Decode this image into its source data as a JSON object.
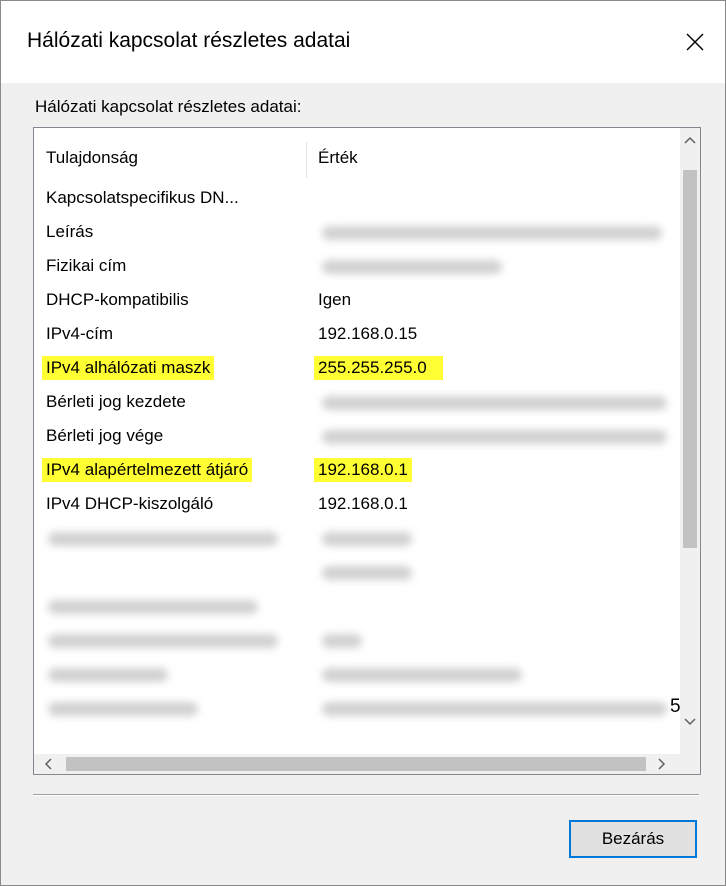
{
  "dialog": {
    "title": "Hálózati kapcsolat részletes adatai",
    "group_label": "Hálózati kapcsolat részletes adatai:",
    "close_button_label": "Bezárás"
  },
  "listview": {
    "columns": [
      "Tulajdonság",
      "Érték"
    ],
    "rows": [
      {
        "prop": "Kapcsolatspecifikus DN...",
        "val": ""
      },
      {
        "prop": "Leírás",
        "val": ""
      },
      {
        "prop": "Fizikai cím",
        "val": ""
      },
      {
        "prop": "DHCP-kompatibilis",
        "val": "Igen"
      },
      {
        "prop": "IPv4-cím",
        "val": "192.168.0.15"
      },
      {
        "prop": "IPv4 alhálózati maszk",
        "val": "255.255.255.0"
      },
      {
        "prop": "Bérleti jog kezdete",
        "val": ""
      },
      {
        "prop": "Bérleti jog vége",
        "val": ""
      },
      {
        "prop": "IPv4 alapértelmezett átjáró",
        "val": "192.168.0.1"
      },
      {
        "prop": "IPv4 DHCP-kiszolgáló",
        "val": "192.168.0.1"
      }
    ],
    "overflow_glyph": "5"
  },
  "colors": {
    "highlight": "#ffff33",
    "focus_border": "#0078d7"
  }
}
